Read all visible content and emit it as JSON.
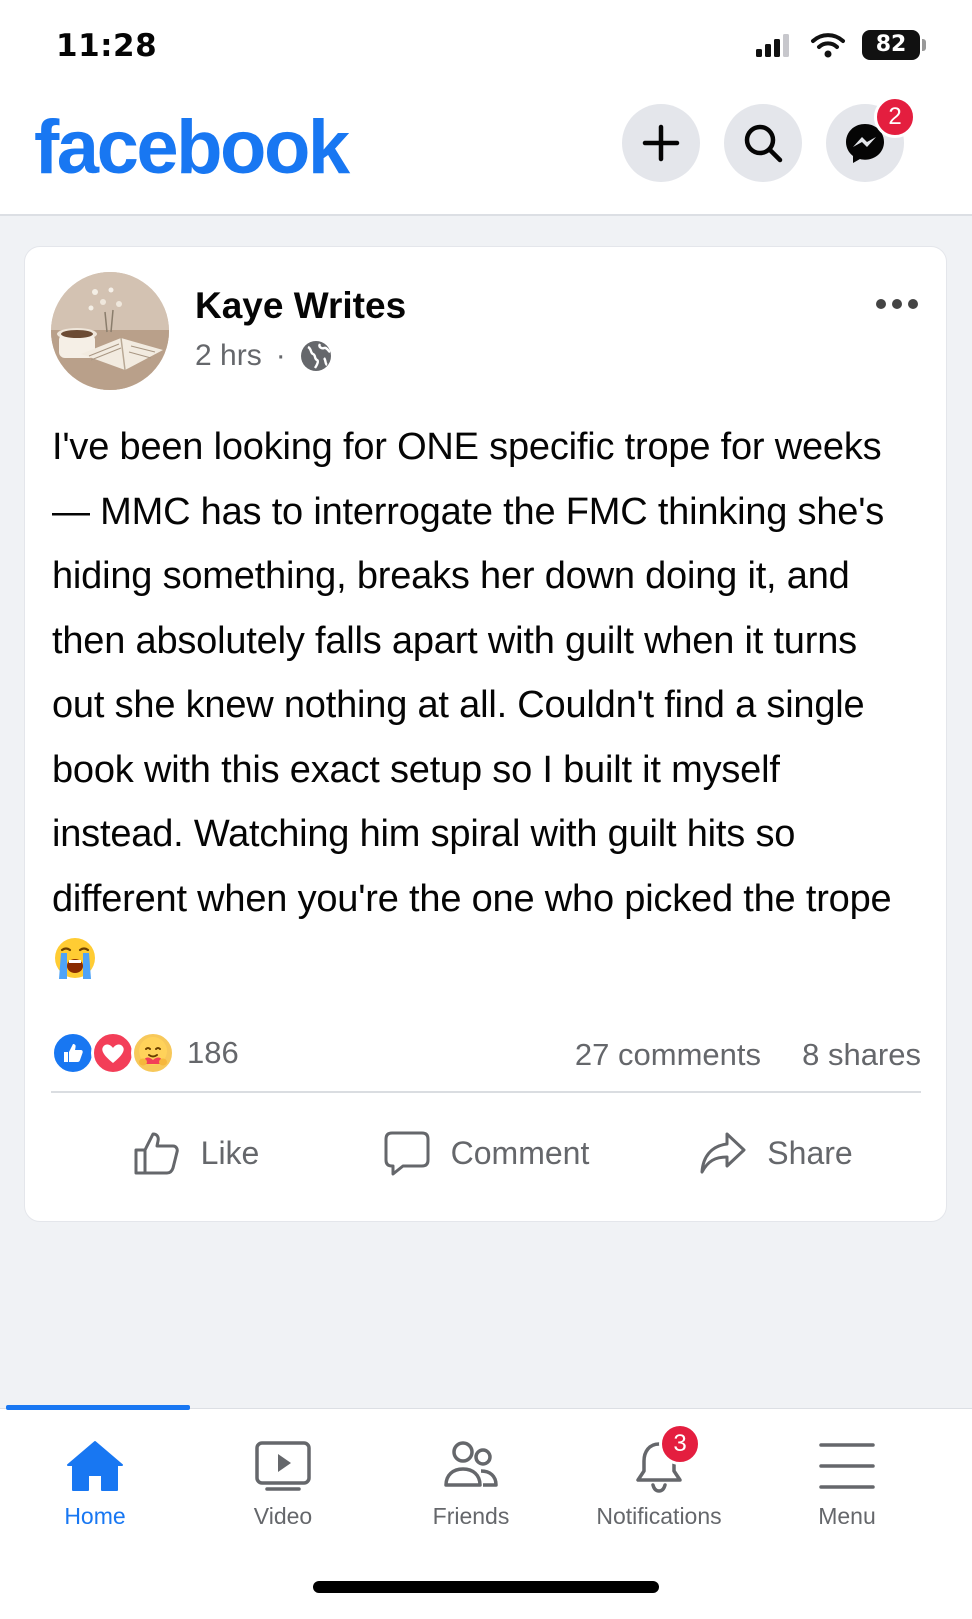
{
  "status_bar": {
    "time": "11:28",
    "battery": "82"
  },
  "header": {
    "logo": "facebook",
    "messenger_badge": "2",
    "icons": [
      "plus-icon",
      "search-icon",
      "messenger-icon"
    ]
  },
  "post": {
    "author": "Kaye Writes",
    "time": "2 hrs",
    "separator": "·",
    "text": "I've been looking for ONE specific trope for weeks — MMC has to interrogate the FMC thinking she's hiding something, breaks her down doing it, and then absolutely falls apart with guilt when it turns out she knew nothing at all. Couldn't find a single book with this exact setup so I built it myself instead. Watching him spiral with guilt hits so different when you're the one who picked the trope",
    "emoji": "loudly-crying-face",
    "reactions": {
      "count": "186",
      "types": [
        "like",
        "love",
        "care"
      ]
    },
    "comments": "27 comments",
    "shares": "8 shares",
    "actions": {
      "like": "Like",
      "comment": "Comment",
      "share": "Share"
    }
  },
  "bottom_nav": {
    "items": [
      {
        "label": "Home",
        "active": true
      },
      {
        "label": "Video"
      },
      {
        "label": "Friends"
      },
      {
        "label": "Notifications",
        "badge": "3"
      },
      {
        "label": "Menu"
      }
    ]
  },
  "colors": {
    "brand": "#1877f2",
    "badge": "#e41e3f",
    "secondary_text": "#65676b"
  }
}
